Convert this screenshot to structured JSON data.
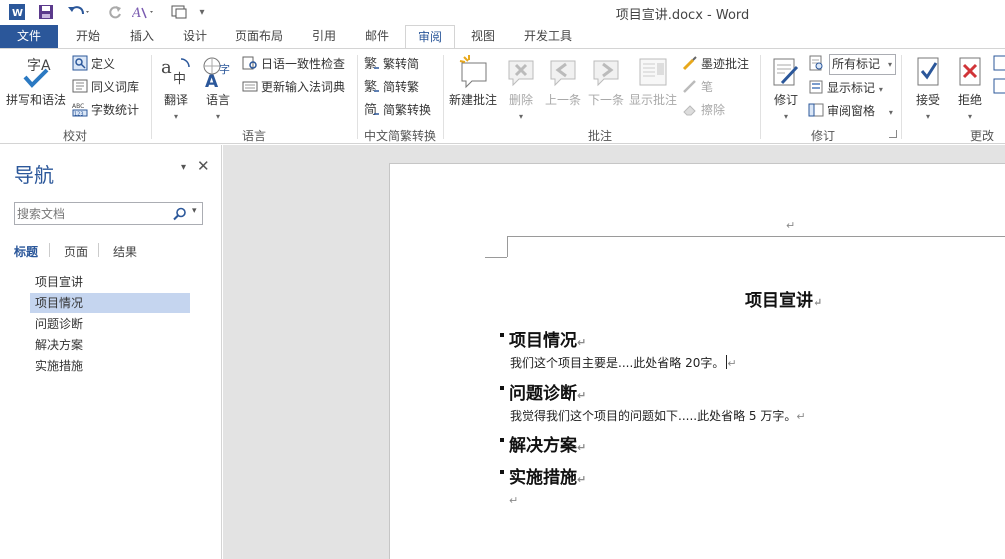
{
  "app": {
    "document_title": "项目宣讲.docx - Word"
  },
  "tabs": [
    "文件",
    "开始",
    "插入",
    "设计",
    "页面布局",
    "引用",
    "邮件",
    "审阅",
    "视图",
    "开发工具"
  ],
  "ribbon": {
    "proofing": {
      "group_label": "校对",
      "spelling": "拼写和语法",
      "define": "定义",
      "thesaurus": "同义词库",
      "word_count": "字数统计"
    },
    "language": {
      "group_label": "语言",
      "translate": "翻译",
      "language": "语言",
      "japanese_consistency": "日语一致性检查",
      "update_ime_dict": "更新输入法词典"
    },
    "chinese_conversion": {
      "group_label": "中文简繁转换",
      "to_simplified": "繁转简",
      "to_traditional": "简转繁",
      "conversion": "简繁转换"
    },
    "comments": {
      "group_label": "批注",
      "new_comment": "新建批注",
      "delete": "删除",
      "previous": "上一条",
      "next": "下一条",
      "show_comments": "显示批注",
      "ink_comment": "墨迹批注",
      "pen": "笔",
      "eraser": "擦除"
    },
    "tracking": {
      "group_label": "修订",
      "track_changes": "修订",
      "markup_select": "所有标记",
      "show_markup": "显示标记",
      "reviewing_pane": "审阅窗格"
    },
    "changes": {
      "group_label": "更改",
      "accept": "接受",
      "reject": "拒绝"
    }
  },
  "nav": {
    "title": "导航",
    "search_placeholder": "搜索文档",
    "tabs": [
      "标题",
      "页面",
      "结果"
    ],
    "headings": [
      "项目宣讲",
      "项目情况",
      "问题诊断",
      "解决方案",
      "实施措施"
    ],
    "selected_heading": "项目情况"
  },
  "document": {
    "title": "项目宣讲",
    "sections": [
      {
        "heading": "项目情况",
        "body": "我们这个项目主要是....此处省略 20字。"
      },
      {
        "heading": "问题诊断",
        "body": "我觉得我们这个项目的问题如下.....此处省略 5 万字。"
      },
      {
        "heading": "解决方案",
        "body": ""
      },
      {
        "heading": "实施措施",
        "body": ""
      }
    ],
    "para_mark": "↵"
  },
  "colors": {
    "accent": "#2b579a",
    "nav_selected": "#c5d5ef",
    "doc_background": "#e3e3e3"
  }
}
